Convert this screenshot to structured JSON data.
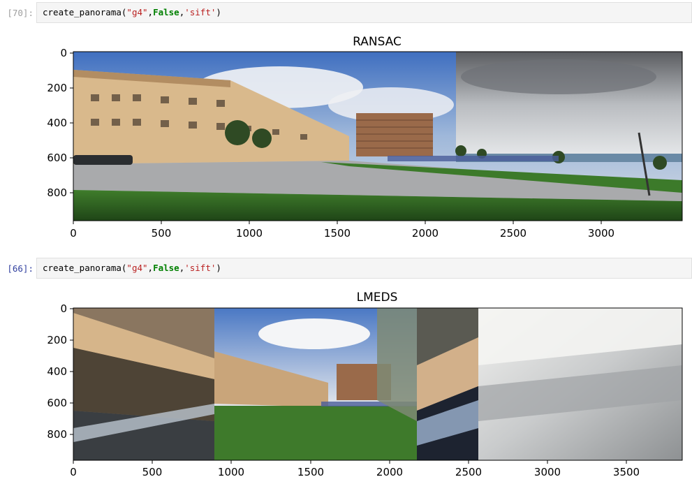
{
  "cells": [
    {
      "prompt": "[70]:",
      "code": {
        "fn": "create_panorama",
        "arg1": "\"g4\"",
        "arg2": "False",
        "arg3": "'sift'"
      },
      "plot": {
        "title": "RANSAC",
        "xticks": [
          "0",
          "500",
          "1000",
          "1500",
          "2000",
          "2500",
          "3000"
        ],
        "yticks": [
          "0",
          "200",
          "400",
          "600",
          "800"
        ]
      }
    },
    {
      "prompt": "[66]:",
      "code": {
        "fn": "create_panorama",
        "arg1": "\"g4\"",
        "arg2": "False",
        "arg3": "'sift'"
      },
      "plot": {
        "title": "LMEDS",
        "xticks": [
          "0",
          "500",
          "1000",
          "1500",
          "2000",
          "2500",
          "3000",
          "3500"
        ],
        "yticks": [
          "0",
          "200",
          "400",
          "600",
          "800"
        ]
      }
    }
  ],
  "colors": {
    "prompt_old": "#9e9e9e",
    "prompt_new": "#303f9f",
    "string": "#ba2121",
    "keyword": "#008000"
  }
}
